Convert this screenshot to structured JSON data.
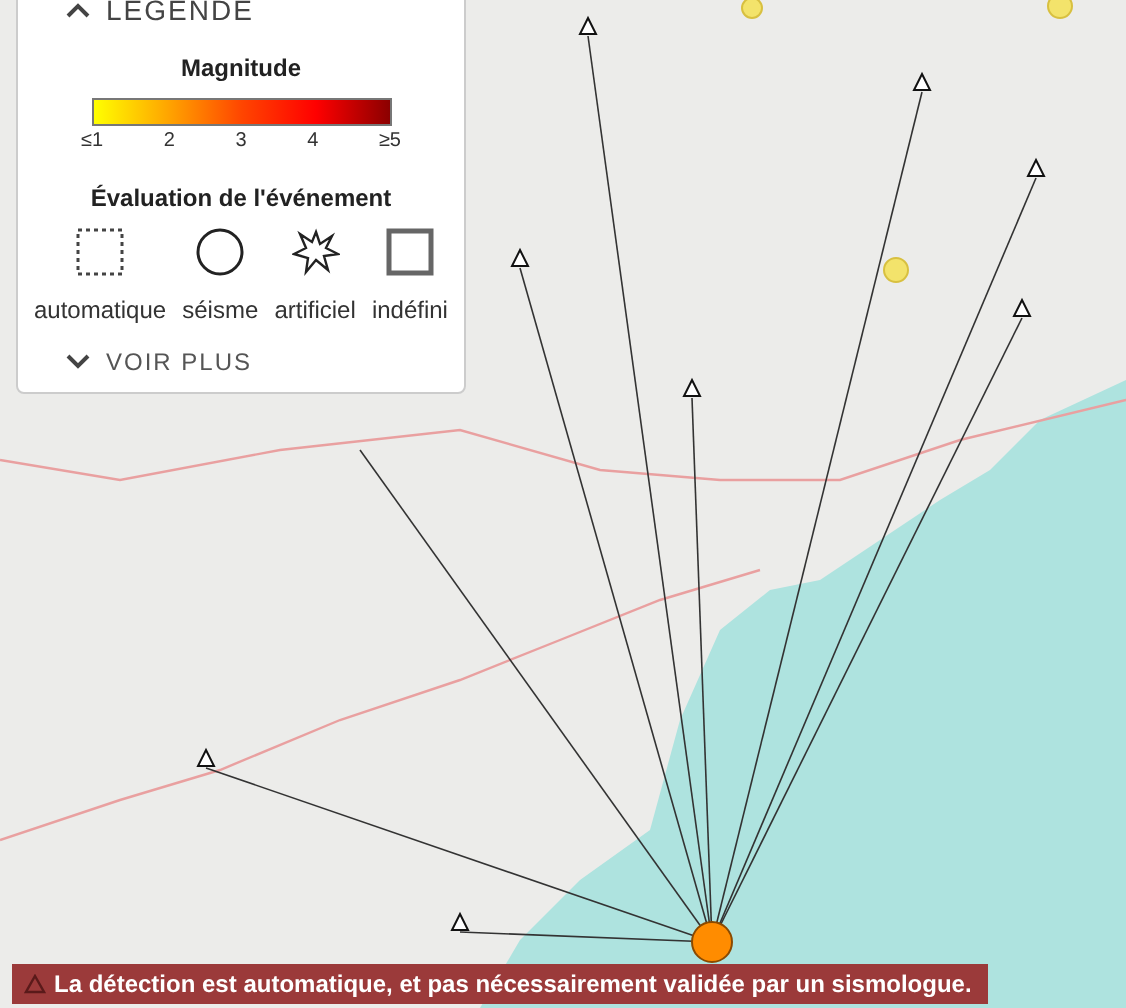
{
  "legend": {
    "title": "LEGENDE",
    "expanded": true,
    "magnitude_title": "Magnitude",
    "magnitude_ticks": [
      "≤1",
      "2",
      "3",
      "4",
      "≥5"
    ],
    "evaluation_title": "Évaluation de l'événement",
    "evaluation_types": [
      {
        "kind": "dotted-square",
        "label": "automatique"
      },
      {
        "kind": "circle",
        "label": "séisme"
      },
      {
        "kind": "burst",
        "label": "artificiel"
      },
      {
        "kind": "square",
        "label": "indéfini"
      }
    ],
    "more": {
      "label": "VOIR PLUS",
      "expanded": false
    }
  },
  "alert": {
    "text": "La détection est automatique, et pas nécessairement validée par un sismologue."
  }
}
